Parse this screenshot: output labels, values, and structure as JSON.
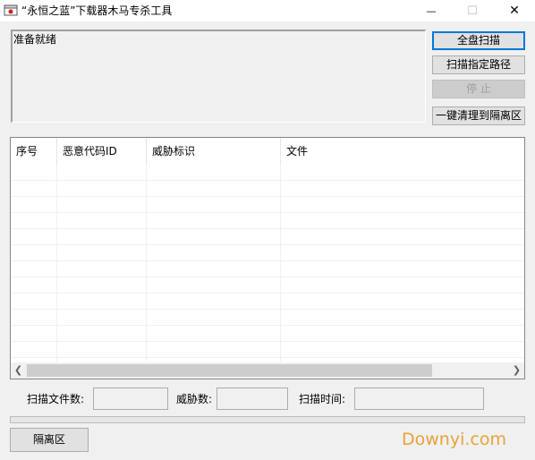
{
  "window": {
    "title": "“永恒之蓝”下载器木马专杀工具",
    "minimize_glyph": "—",
    "maximize_glyph": "☐",
    "close_glyph": "✕"
  },
  "log": {
    "text": "准备就绪"
  },
  "buttons": {
    "full_scan": "全盘扫描",
    "scan_path": "扫描指定路径",
    "stop": "停 止",
    "quarantine_all": "一键清理到隔离区",
    "quarantine_zone": "隔离区"
  },
  "table": {
    "columns": [
      "序号",
      "恶意代码ID",
      "威胁标识",
      "文件"
    ]
  },
  "stats": {
    "files_label": "扫描文件数:",
    "files_value": "",
    "threats_label": "威胁数:",
    "threats_value": "",
    "time_label": "扫描时间:",
    "time_value": ""
  },
  "watermark": "Downyi.com",
  "colors": {
    "accent": "#0078d7",
    "watermark": "#e8a23a"
  }
}
